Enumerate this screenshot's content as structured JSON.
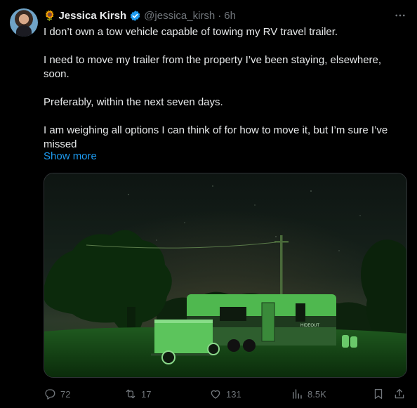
{
  "tweet": {
    "author": {
      "emoji": "🌻",
      "name": "Jessica Kirsh",
      "handle": "@jessica_kirsh",
      "separator": "·",
      "time": "6h"
    },
    "paragraphs": [
      "I don’t own a tow vehicle capable of towing my RV travel trailer.",
      "I need to move my trailer from the  property I’ve been staying, elsewhere, soon.",
      "Preferably, within the next seven days.",
      "I am weighing all options I can think of for how to move it, but I’m sure I’ve missed"
    ],
    "show_more": "Show more",
    "trailer_brand": "HIDEOUT",
    "metrics": {
      "replies": "72",
      "reposts": "17",
      "likes": "131",
      "views": "8.5K"
    }
  },
  "colors": {
    "accent": "#1d9bf0",
    "muted": "#71767b",
    "text": "#e7e9ea",
    "background": "#000000"
  },
  "icons": [
    "verified-badge-icon",
    "more-icon",
    "reply-icon",
    "repost-icon",
    "like-icon",
    "views-icon",
    "bookmark-icon",
    "share-icon"
  ]
}
